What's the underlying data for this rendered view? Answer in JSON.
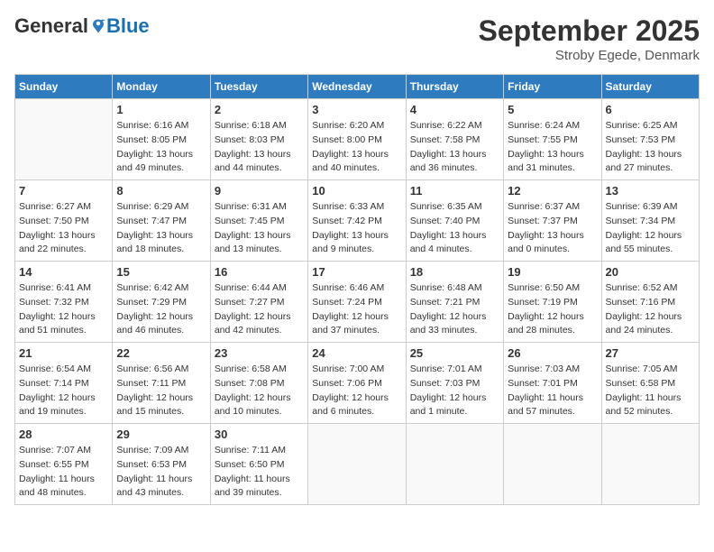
{
  "header": {
    "logo": {
      "general": "General",
      "blue": "Blue"
    },
    "title": "September 2025",
    "subtitle": "Stroby Egede, Denmark"
  },
  "calendar": {
    "days_of_week": [
      "Sunday",
      "Monday",
      "Tuesday",
      "Wednesday",
      "Thursday",
      "Friday",
      "Saturday"
    ],
    "weeks": [
      [
        {
          "day": "",
          "info": ""
        },
        {
          "day": "1",
          "info": "Sunrise: 6:16 AM\nSunset: 8:05 PM\nDaylight: 13 hours\nand 49 minutes."
        },
        {
          "day": "2",
          "info": "Sunrise: 6:18 AM\nSunset: 8:03 PM\nDaylight: 13 hours\nand 44 minutes."
        },
        {
          "day": "3",
          "info": "Sunrise: 6:20 AM\nSunset: 8:00 PM\nDaylight: 13 hours\nand 40 minutes."
        },
        {
          "day": "4",
          "info": "Sunrise: 6:22 AM\nSunset: 7:58 PM\nDaylight: 13 hours\nand 36 minutes."
        },
        {
          "day": "5",
          "info": "Sunrise: 6:24 AM\nSunset: 7:55 PM\nDaylight: 13 hours\nand 31 minutes."
        },
        {
          "day": "6",
          "info": "Sunrise: 6:25 AM\nSunset: 7:53 PM\nDaylight: 13 hours\nand 27 minutes."
        }
      ],
      [
        {
          "day": "7",
          "info": "Sunrise: 6:27 AM\nSunset: 7:50 PM\nDaylight: 13 hours\nand 22 minutes."
        },
        {
          "day": "8",
          "info": "Sunrise: 6:29 AM\nSunset: 7:47 PM\nDaylight: 13 hours\nand 18 minutes."
        },
        {
          "day": "9",
          "info": "Sunrise: 6:31 AM\nSunset: 7:45 PM\nDaylight: 13 hours\nand 13 minutes."
        },
        {
          "day": "10",
          "info": "Sunrise: 6:33 AM\nSunset: 7:42 PM\nDaylight: 13 hours\nand 9 minutes."
        },
        {
          "day": "11",
          "info": "Sunrise: 6:35 AM\nSunset: 7:40 PM\nDaylight: 13 hours\nand 4 minutes."
        },
        {
          "day": "12",
          "info": "Sunrise: 6:37 AM\nSunset: 7:37 PM\nDaylight: 13 hours\nand 0 minutes."
        },
        {
          "day": "13",
          "info": "Sunrise: 6:39 AM\nSunset: 7:34 PM\nDaylight: 12 hours\nand 55 minutes."
        }
      ],
      [
        {
          "day": "14",
          "info": "Sunrise: 6:41 AM\nSunset: 7:32 PM\nDaylight: 12 hours\nand 51 minutes."
        },
        {
          "day": "15",
          "info": "Sunrise: 6:42 AM\nSunset: 7:29 PM\nDaylight: 12 hours\nand 46 minutes."
        },
        {
          "day": "16",
          "info": "Sunrise: 6:44 AM\nSunset: 7:27 PM\nDaylight: 12 hours\nand 42 minutes."
        },
        {
          "day": "17",
          "info": "Sunrise: 6:46 AM\nSunset: 7:24 PM\nDaylight: 12 hours\nand 37 minutes."
        },
        {
          "day": "18",
          "info": "Sunrise: 6:48 AM\nSunset: 7:21 PM\nDaylight: 12 hours\nand 33 minutes."
        },
        {
          "day": "19",
          "info": "Sunrise: 6:50 AM\nSunset: 7:19 PM\nDaylight: 12 hours\nand 28 minutes."
        },
        {
          "day": "20",
          "info": "Sunrise: 6:52 AM\nSunset: 7:16 PM\nDaylight: 12 hours\nand 24 minutes."
        }
      ],
      [
        {
          "day": "21",
          "info": "Sunrise: 6:54 AM\nSunset: 7:14 PM\nDaylight: 12 hours\nand 19 minutes."
        },
        {
          "day": "22",
          "info": "Sunrise: 6:56 AM\nSunset: 7:11 PM\nDaylight: 12 hours\nand 15 minutes."
        },
        {
          "day": "23",
          "info": "Sunrise: 6:58 AM\nSunset: 7:08 PM\nDaylight: 12 hours\nand 10 minutes."
        },
        {
          "day": "24",
          "info": "Sunrise: 7:00 AM\nSunset: 7:06 PM\nDaylight: 12 hours\nand 6 minutes."
        },
        {
          "day": "25",
          "info": "Sunrise: 7:01 AM\nSunset: 7:03 PM\nDaylight: 12 hours\nand 1 minute."
        },
        {
          "day": "26",
          "info": "Sunrise: 7:03 AM\nSunset: 7:01 PM\nDaylight: 11 hours\nand 57 minutes."
        },
        {
          "day": "27",
          "info": "Sunrise: 7:05 AM\nSunset: 6:58 PM\nDaylight: 11 hours\nand 52 minutes."
        }
      ],
      [
        {
          "day": "28",
          "info": "Sunrise: 7:07 AM\nSunset: 6:55 PM\nDaylight: 11 hours\nand 48 minutes."
        },
        {
          "day": "29",
          "info": "Sunrise: 7:09 AM\nSunset: 6:53 PM\nDaylight: 11 hours\nand 43 minutes."
        },
        {
          "day": "30",
          "info": "Sunrise: 7:11 AM\nSunset: 6:50 PM\nDaylight: 11 hours\nand 39 minutes."
        },
        {
          "day": "",
          "info": ""
        },
        {
          "day": "",
          "info": ""
        },
        {
          "day": "",
          "info": ""
        },
        {
          "day": "",
          "info": ""
        }
      ]
    ]
  }
}
